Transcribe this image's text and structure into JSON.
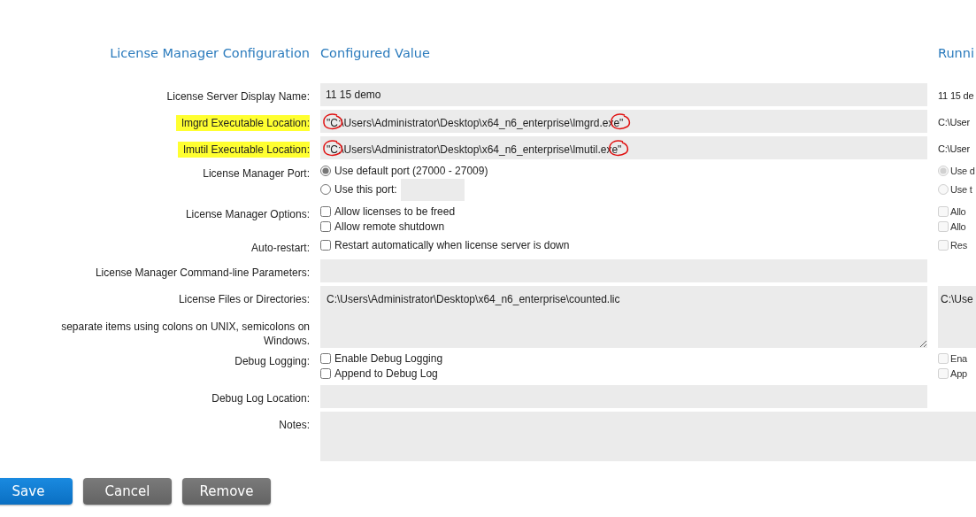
{
  "columns": [
    {
      "title": "License Manager Configuration"
    },
    {
      "title": "Configured Value"
    },
    {
      "title": "Runni"
    }
  ],
  "rows": [
    {
      "kind": "text",
      "label": "License Server Display Name:",
      "value": "11 15 demo",
      "running": "11 15 de"
    },
    {
      "kind": "text",
      "label": "lmgrd Executable Location:",
      "highlighted": true,
      "marked": true,
      "value": "\"C:\\Users\\Administrator\\Desktop\\x64_n6_enterprise\\lmgrd.exe\"",
      "running": "C:\\User"
    },
    {
      "kind": "text",
      "label": "lmutil Executable Location:",
      "highlighted": true,
      "marked": true,
      "value": "\"C:\\Users\\Administrator\\Desktop\\x64_n6_enterprise\\lmutil.exe\"",
      "running": "C:\\User"
    },
    {
      "kind": "port",
      "label": "License Manager Port:",
      "options": [
        {
          "label": "Use default port (27000 - 27009)",
          "selected": true,
          "running": "Use d",
          "running_selected": true
        },
        {
          "label": "Use this port:",
          "selected": false,
          "running": "Use t",
          "running_selected": false
        }
      ]
    },
    {
      "kind": "checks",
      "label": "License Manager Options:",
      "items": [
        {
          "label": "Allow licenses to be freed",
          "checked": false,
          "running": "Allo",
          "running_checked": false
        },
        {
          "label": "Allow remote shutdown",
          "checked": false,
          "running": "Allo",
          "running_checked": false
        }
      ]
    },
    {
      "kind": "checks",
      "label": "Auto-restart:",
      "items": [
        {
          "label": "Restart automatically when license server is down",
          "checked": false,
          "running": "Res",
          "running_checked": false
        }
      ]
    },
    {
      "kind": "text",
      "label": "License Manager Command-line Parameters:"
    },
    {
      "kind": "textarea",
      "label": "License Files or Directories:",
      "note": "separate items using colons on UNIX, semicolons on Windows.",
      "value": "C:\\Users\\Administrator\\Desktop\\x64_n6_enterprise\\counted.lic",
      "running": "C:\\Use"
    },
    {
      "kind": "checks",
      "label": "Debug Logging:",
      "items": [
        {
          "label": "Enable Debug Logging",
          "checked": false,
          "running": "Ena",
          "running_checked": false
        },
        {
          "label": "Append to Debug Log",
          "checked": false,
          "running": "App",
          "running_checked": false
        }
      ]
    },
    {
      "kind": "text",
      "label": "Debug Log Location:"
    },
    {
      "kind": "notes",
      "label": "Notes:"
    }
  ],
  "buttons": [
    {
      "label": "Save",
      "kind": "primary"
    },
    {
      "label": "Cancel",
      "kind": "secondary"
    },
    {
      "label": "Remove",
      "kind": "secondary"
    }
  ]
}
